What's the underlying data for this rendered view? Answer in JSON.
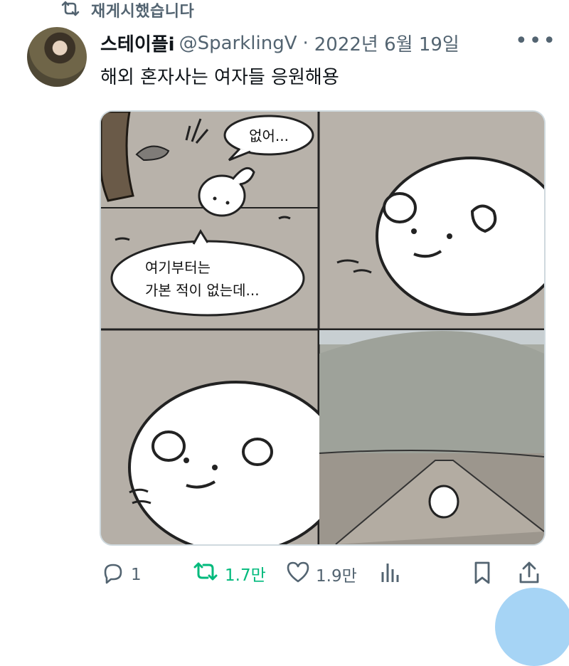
{
  "reposted": {
    "label": "재게시했습니다"
  },
  "tweet": {
    "display_name": "스테이플i",
    "handle": "@SparklingV",
    "separator": "·",
    "date": "2022년 6월 19일",
    "text": "해외 혼자사는 여자들 응원해용"
  },
  "comic": {
    "bubble_1": "없어...",
    "bubble_2_line1": "여기부터는",
    "bubble_2_line2": "가본 적이 없는데..."
  },
  "actions": {
    "reply_count": "1",
    "retweet_count": "1.7만",
    "like_count": "1.9만"
  },
  "colors": {
    "secondary_text": "#536471",
    "retweet_active": "#00ba7c",
    "panel_bg": "#b9b3aa",
    "border": "#cfd9de"
  },
  "icons": [
    "retweet-icon",
    "more-icon",
    "reply-icon",
    "like-icon",
    "views-icon",
    "bookmark-icon",
    "share-icon"
  ]
}
